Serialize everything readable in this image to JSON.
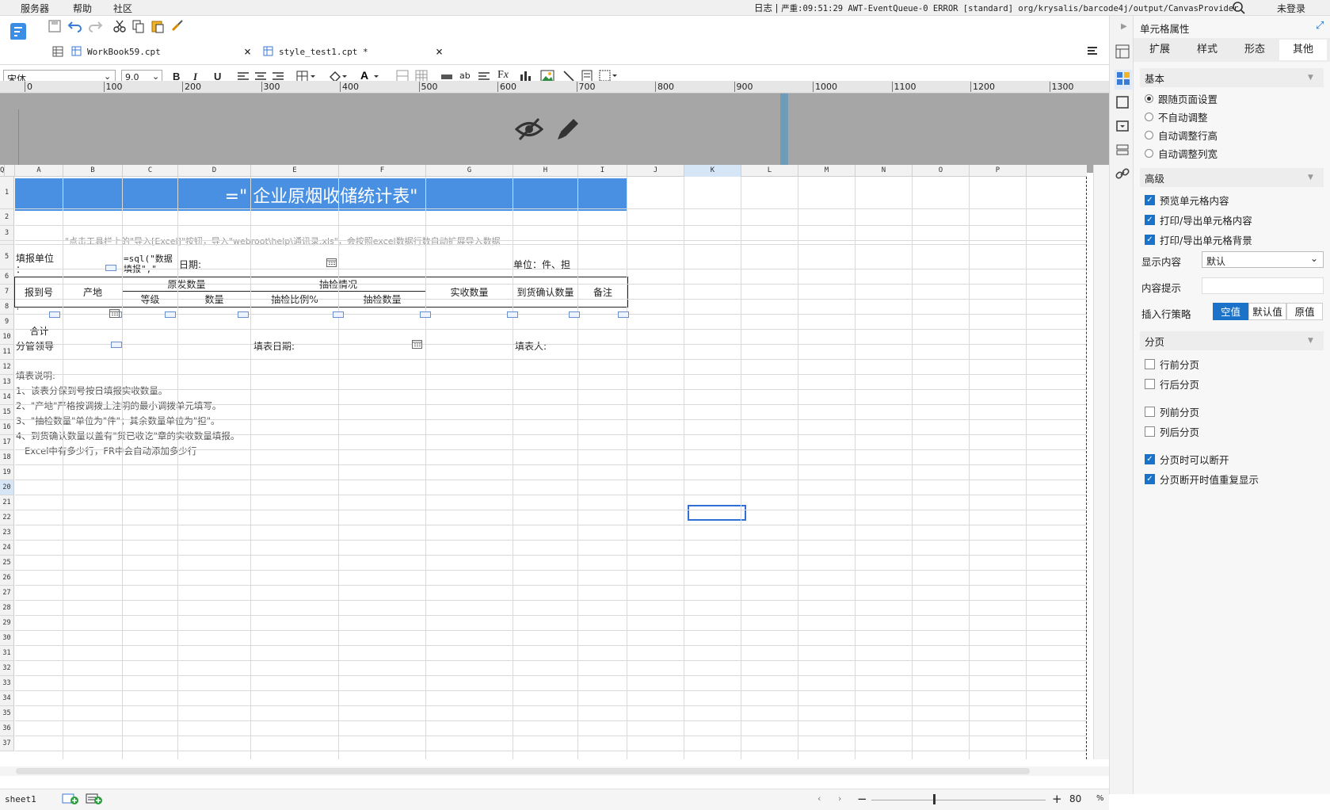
{
  "menubar": {
    "items": [
      "服务器",
      "帮助",
      "社区"
    ],
    "log_label": "日志",
    "error_text": "严重:09:51:29 AWT-EventQueue-0 ERROR [standard] org/krysalis/barcode4j/output/CanvasProvider",
    "login": "未登录"
  },
  "tabs": [
    {
      "label": "WorkBook59.cpt"
    },
    {
      "label": "style_test1.cpt *"
    }
  ],
  "format": {
    "font": "宋体",
    "size": "9.0"
  },
  "ruler": {
    "marks": [
      "0",
      "100",
      "200",
      "300",
      "400",
      "500",
      "600",
      "700",
      "800",
      "900",
      "1000",
      "1100",
      "1200",
      "1300"
    ]
  },
  "grid": {
    "columns": [
      "A",
      "B",
      "C",
      "D",
      "E",
      "F",
      "G",
      "H",
      "I",
      "J",
      "K",
      "L",
      "M",
      "N",
      "O",
      "P",
      "Q"
    ],
    "rows": [
      "1",
      "2",
      "3",
      "4",
      "5",
      "6",
      "7",
      "8",
      "9",
      "10",
      "11",
      "12",
      "13",
      "14",
      "15",
      "16",
      "17",
      "18",
      "19",
      "20",
      "21",
      "22",
      "23",
      "24",
      "25",
      "26",
      "27",
      "28",
      "29",
      "30",
      "31",
      "32",
      "33",
      "34",
      "35",
      "36",
      "37"
    ],
    "title": "=\"   企业原烟收储统计表\"",
    "hint": "\"点击工具栏上的\"导入[Excel]\"按钮，导入\"webroot\\help\\通讯录.xls\"，会按照excel数据行数自动扩展导入数据",
    "report_unit": "填报单位\n：",
    "sql": "=sql(\"数据\n填报\",\"",
    "date_label": "日期:",
    "unit_label": "单位：件、担",
    "headers": {
      "report_no": "报到号",
      "origin": "产地",
      "original_qty": "原发数量",
      "grade": "等级",
      "quantity": "数量",
      "inspection": "抽检情况",
      "inspect_ratio": "抽检比例%",
      "inspect_qty": "抽检数量",
      "received_qty": "实收数量",
      "arrival_qty": "到货确认数量",
      "remark": "备注"
    },
    "row8_a": "'",
    "total": "合计",
    "leader": "分管领导",
    "fill_date": "填表日期:",
    "filler": "填表人:",
    "notes": [
      "填表说明:",
      "1、该表分保到号按日填报实收数量。",
      "2、\"产地\"严格按调拨上注明的最小调拨单元填写。",
      "3、\"抽检数量\"单位为\"件\"；其余数量单位为\"担\"。",
      "4、到货确认数量以盖有\"货已收讫\"章的实收数量填报。",
      "   Excel中有多少行，FR中会自动添加多少行"
    ]
  },
  "status": {
    "sheet": "sheet1",
    "zoom": "80",
    "percent": "%"
  },
  "panel": {
    "title": "单元格属性",
    "tabs": [
      "扩展",
      "样式",
      "形态",
      "其他"
    ],
    "active_tab": "其他",
    "basic": {
      "label": "基本",
      "options": [
        {
          "label": "跟随页面设置",
          "selected": true
        },
        {
          "label": "不自动调整",
          "selected": false
        },
        {
          "label": "自动调整行高",
          "selected": false
        },
        {
          "label": "自动调整列宽",
          "selected": false
        }
      ]
    },
    "advanced": {
      "label": "高级",
      "checks": [
        {
          "label": "预览单元格内容",
          "checked": true
        },
        {
          "label": "打印/导出单元格内容",
          "checked": true
        },
        {
          "label": "打印/导出单元格背景",
          "checked": true
        }
      ],
      "display_label": "显示内容",
      "display_value": "默认",
      "tip_label": "内容提示",
      "tip_value": "",
      "insert_label": "插入行策略",
      "insert_options": [
        "空值",
        "默认值",
        "原值"
      ],
      "insert_selected": "空值"
    },
    "paging": {
      "label": "分页",
      "checks": [
        {
          "label": "行前分页",
          "checked": false
        },
        {
          "label": "行后分页",
          "checked": false
        },
        {
          "label": "列前分页",
          "checked": false
        },
        {
          "label": "列后分页",
          "checked": false
        },
        {
          "label": "分页时可以断开",
          "checked": true
        },
        {
          "label": "分页断开时值重复显示",
          "checked": true
        }
      ]
    }
  },
  "colors": {
    "title_bg": "#4a90e2",
    "accent": "#1a73c8",
    "selection": "#2f6fd6"
  }
}
